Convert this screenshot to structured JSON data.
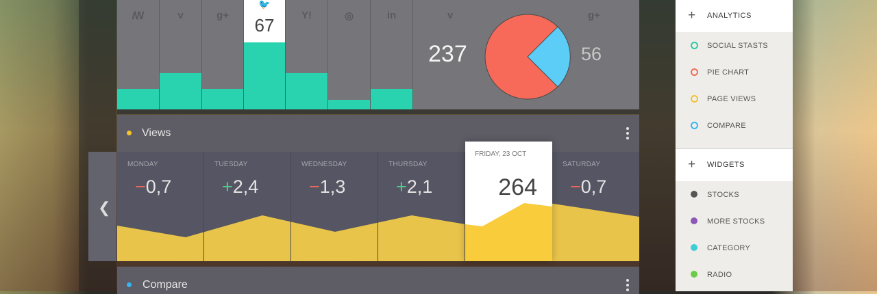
{
  "social_panel": {
    "columns": [
      {
        "icon": "stumbleupon-icon",
        "glyph": "ꟿ",
        "value_fraction": 0.19
      },
      {
        "icon": "vimeo-icon",
        "glyph": "v",
        "value_fraction": 0.33
      },
      {
        "icon": "googleplus-icon",
        "glyph": "g+",
        "value_fraction": 0.19
      },
      {
        "icon": "twitter-icon",
        "glyph": "🐦",
        "value": "67",
        "highlighted": true,
        "value_fraction": 0.62
      },
      {
        "icon": "yahoo-icon",
        "glyph": "Y!",
        "value_fraction": 0.33
      },
      {
        "icon": "dribbble-icon",
        "glyph": "◎",
        "value_fraction": 0.09
      },
      {
        "icon": "linkedin-icon",
        "glyph": "in",
        "value_fraction": 0.19
      }
    ],
    "pie": {
      "left_icon": "vimeo-icon",
      "left_glyph": "v",
      "right_icon": "googleplus-icon",
      "right_glyph": "g+",
      "left_value": "237",
      "right_value": "56",
      "colors": {
        "main": "#f76a5a",
        "slice": "#5bcdf7"
      }
    }
  },
  "views": {
    "title": "Views",
    "dot_color": "#f5c42c",
    "days": [
      {
        "name": "MONDAY",
        "sign": "−",
        "value": "0,7",
        "trend": "neg"
      },
      {
        "name": "TUESDAY",
        "sign": "+",
        "value": "2,4",
        "trend": "pos"
      },
      {
        "name": "WEDNESDAY",
        "sign": "−",
        "value": "1,3",
        "trend": "neg"
      },
      {
        "name": "THURSDAY",
        "sign": "+",
        "value": "2,1",
        "trend": "pos"
      },
      {
        "name": "FRIDAY, 23 OCT",
        "value": "264",
        "highlighted": true
      },
      {
        "name": "SATURDAY",
        "sign": "−",
        "value": "0,7",
        "trend": "neg"
      }
    ],
    "area_color": "#e8c44a",
    "area_highlight_color": "#f9cc3c"
  },
  "compare": {
    "title": "Compare",
    "dot_color": "#36b6f0"
  },
  "sidebar": {
    "analytics": {
      "label": "ANALYTICS",
      "items": [
        {
          "label": "SOCIAL STASTS",
          "color": "#2dc9a6",
          "style": "ring"
        },
        {
          "label": "PIE CHART",
          "color": "#f06a5a",
          "style": "ring"
        },
        {
          "label": "PAGE VIEWS",
          "color": "#f2c332",
          "style": "ring"
        },
        {
          "label": "COMPARE",
          "color": "#36b6f0",
          "style": "ring"
        }
      ]
    },
    "widgets": {
      "label": "WIDGETS",
      "items": [
        {
          "label": "STOCKS",
          "color": "#555555",
          "style": "fill"
        },
        {
          "label": "MORE STOCKS",
          "color": "#8b57b8",
          "style": "fill"
        },
        {
          "label": "CATEGORY",
          "color": "#3ecdd6",
          "style": "fill"
        },
        {
          "label": "RADIO",
          "color": "#6ccb4a",
          "style": "fill"
        }
      ]
    }
  }
}
